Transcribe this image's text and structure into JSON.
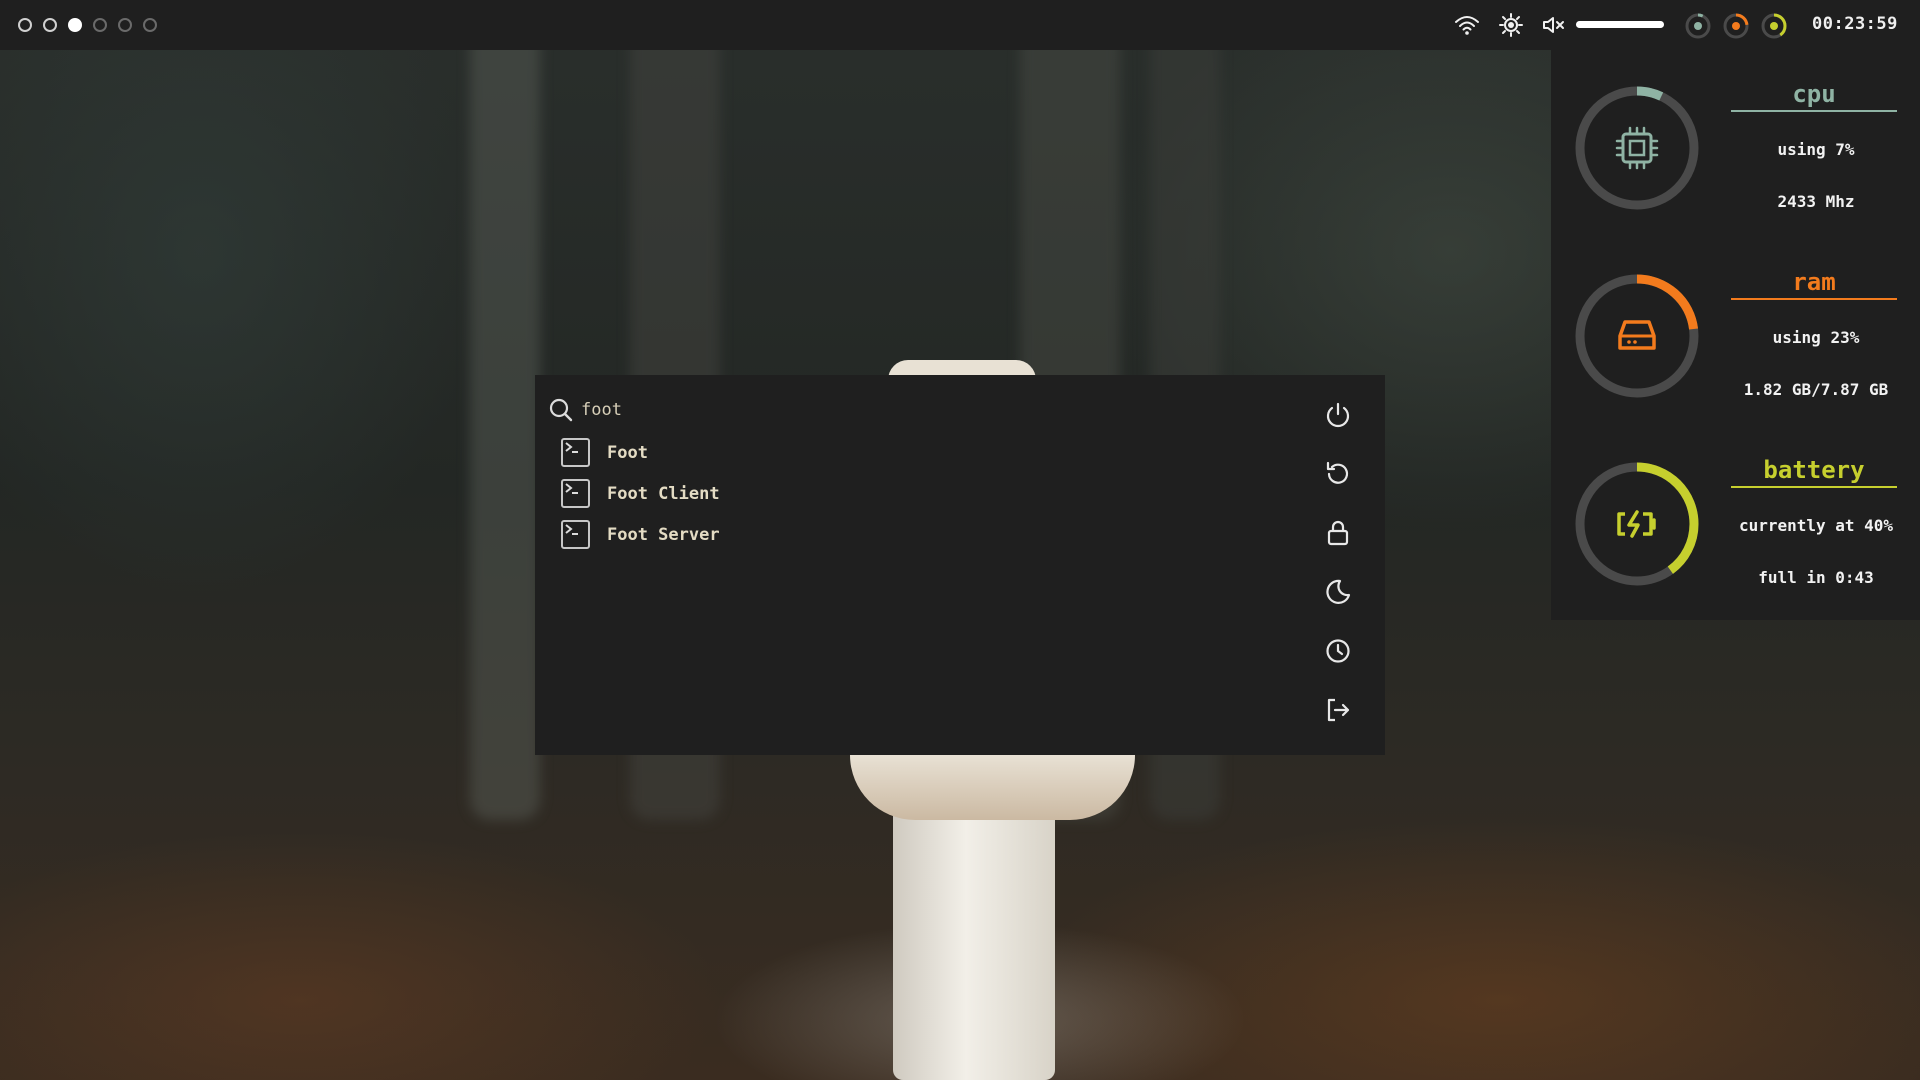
{
  "workspaces": [
    {
      "id": 1,
      "state": "occupied"
    },
    {
      "id": 2,
      "state": "occupied"
    },
    {
      "id": 3,
      "state": "active"
    },
    {
      "id": 4,
      "state": "empty"
    },
    {
      "id": 5,
      "state": "empty"
    },
    {
      "id": 6,
      "state": "empty"
    }
  ],
  "tray": {
    "icons": [
      "wifi-icon",
      "brightness-icon",
      "volume-muted-icon"
    ],
    "volume_level": 1.0,
    "mini_rings": [
      {
        "name": "cpu-mini-ring",
        "color": "#8fb3a4",
        "percent": 7
      },
      {
        "name": "ram-mini-ring",
        "color": "#f37b1d",
        "percent": 23
      },
      {
        "name": "battery-mini-ring",
        "color": "#c6cf2e",
        "percent": 40
      }
    ],
    "clock": "00:23:59"
  },
  "launcher": {
    "search_icon": "search-icon",
    "query": "foot",
    "results": [
      {
        "label": "Foot",
        "icon": "terminal-icon"
      },
      {
        "label": "Foot Client",
        "icon": "terminal-icon"
      },
      {
        "label": "Foot Server",
        "icon": "terminal-icon"
      }
    ],
    "power_actions": [
      {
        "name": "shutdown-button",
        "icon": "power-icon"
      },
      {
        "name": "reboot-button",
        "icon": "restart-icon"
      },
      {
        "name": "lock-button",
        "icon": "lock-icon"
      },
      {
        "name": "suspend-button",
        "icon": "moon-icon"
      },
      {
        "name": "hibernate-button",
        "icon": "clock-icon"
      },
      {
        "name": "logout-button",
        "icon": "logout-icon"
      }
    ]
  },
  "stats": {
    "cpu": {
      "title": "cpu",
      "usage": "using 7%",
      "detail": "2433 Mhz",
      "percent": 7,
      "color": "#8fb3a4",
      "icon": "cpu-icon"
    },
    "ram": {
      "title": "ram",
      "usage": "using 23%",
      "detail": "1.82 GB/7.87 GB",
      "percent": 23,
      "color": "#f37b1d",
      "icon": "storage-icon"
    },
    "battery": {
      "title": "battery",
      "usage": "currently at 40%",
      "detail": "full in 0:43",
      "percent": 40,
      "color": "#c6cf2e",
      "icon": "battery-charging-icon"
    }
  }
}
